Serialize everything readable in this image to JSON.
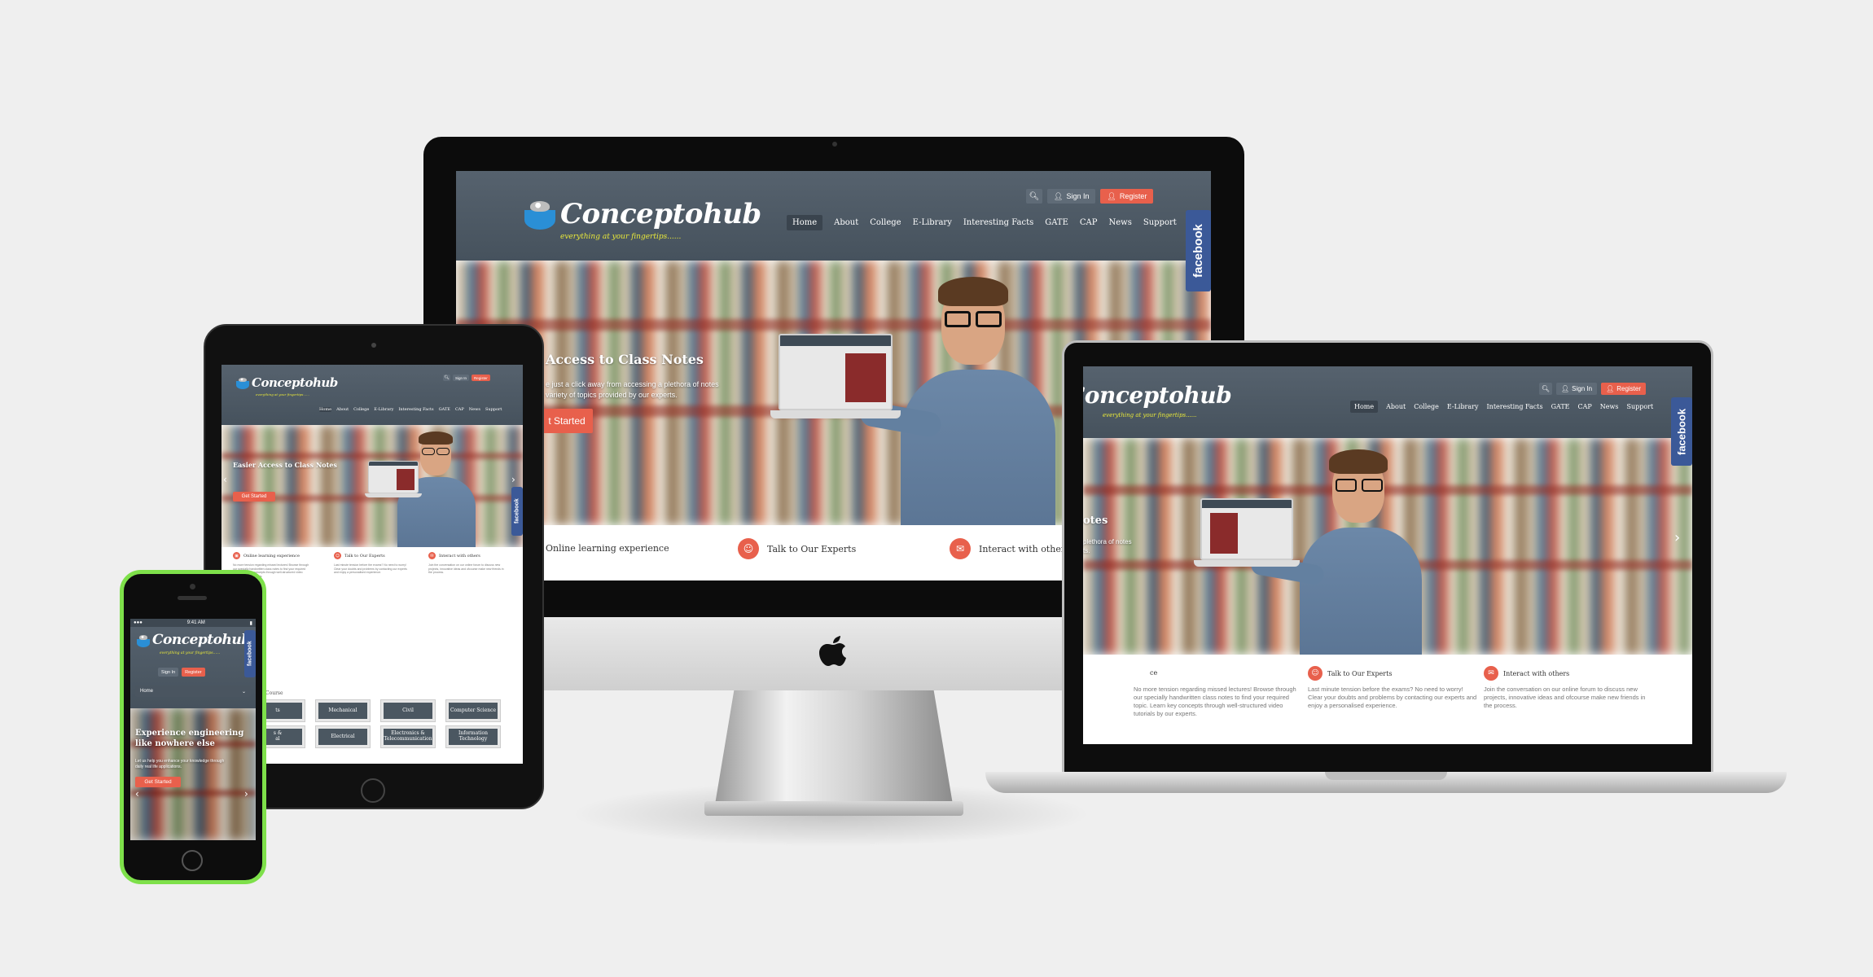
{
  "brand": {
    "name": "Conceptohub",
    "tagline": "everything at your fingertips......"
  },
  "header": {
    "sign_in": "Sign In",
    "register": "Register",
    "search_icon": "search-icon",
    "user_icon": "user-icon"
  },
  "nav": {
    "items": [
      "Home",
      "About",
      "College",
      "E-Library",
      "Interesting Facts",
      "GATE",
      "CAP",
      "News",
      "Support"
    ]
  },
  "facebook": "facebook",
  "hero": {
    "title_desktop": "Access to Class Notes",
    "title_tablet": "Easier Access to Class Notes",
    "title_laptop": "otes",
    "desc_desktop": "e just a click away from accessing a plethora of notes\nvariety of topics provided by our experts.",
    "desc_laptop": "plethora of notes\nts.",
    "cta_desktop": "t Started",
    "cta": "Get Started",
    "prev_icon": "chevron-left-icon",
    "next_icon": "chevron-right-icon"
  },
  "features": {
    "items": [
      {
        "title": "Online learning experience",
        "title_laptop": "ce",
        "desc": "No more tension regarding missed lectures! Browse through our specially handwritten class notes to find your required topic. Learn key concepts through well-structured video tutorials by our experts."
      },
      {
        "title": "Talk to Our Experts",
        "desc": "Last minute tension before the exams? No need to worry! Clear your doubts and problems by contacting our experts and enjoy a personalised experience."
      },
      {
        "title": "Interact with others",
        "desc": "Join the conversation on our online forum to discuss new projects, innovative ideas and ofcourse make new friends in the process."
      }
    ]
  },
  "courses": {
    "heading": "Course",
    "items": [
      "ts",
      "Mechanical",
      "Civil",
      "Computer Science",
      "s &\nal",
      "Electrical",
      "Electronics &\nTelecommunication",
      "Information\nTechnology"
    ]
  },
  "phone": {
    "time": "9:41 AM",
    "select_value": "Home",
    "hero_title": "Experience engineering like nowhere else",
    "hero_desc": "Let us help you enhance your knowledge through daily real life applications.",
    "cta": "Get Started"
  },
  "colors": {
    "header_bg": "#4e5a66",
    "accent": "#e8604c",
    "facebook": "#3b5998",
    "phone_frame": "#7ee04a"
  }
}
